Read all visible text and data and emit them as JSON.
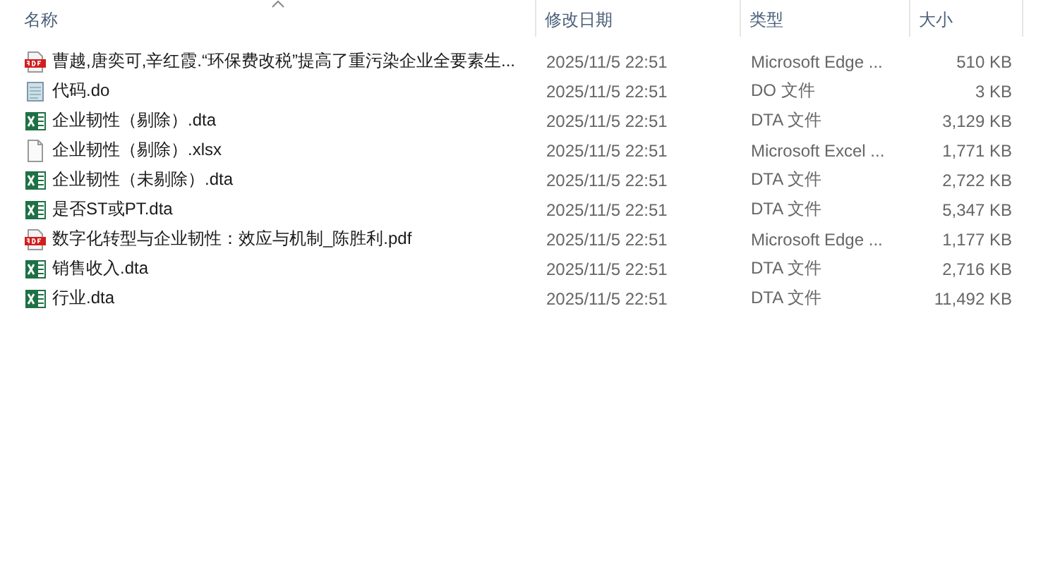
{
  "columns": [
    {
      "label": "名称",
      "sorted": true
    },
    {
      "label": "修改日期",
      "sorted": false
    },
    {
      "label": "类型",
      "sorted": false
    },
    {
      "label": "大小",
      "sorted": false
    }
  ],
  "rows": [
    {
      "kind": "pdf",
      "name": "曹越,唐奕可,辛红霞.“环保费改税”提高了重污染企业全要素生...",
      "date": "2025/11/5 22:51",
      "type": "Microsoft Edge ...",
      "size": "510 KB"
    },
    {
      "kind": "text",
      "name": "代码.do",
      "date": "2025/11/5 22:51",
      "type": "DO 文件",
      "size": "3 KB"
    },
    {
      "kind": "excel",
      "name": "企业韧性（剔除）.dta",
      "date": "2025/11/5 22:51",
      "type": "DTA 文件",
      "size": "3,129 KB"
    },
    {
      "kind": "blank",
      "name": "企业韧性（剔除）.xlsx",
      "date": "2025/11/5 22:51",
      "type": "Microsoft Excel ...",
      "size": "1,771 KB"
    },
    {
      "kind": "excel",
      "name": "企业韧性（未剔除）.dta",
      "date": "2025/11/5 22:51",
      "type": "DTA 文件",
      "size": "2,722 KB"
    },
    {
      "kind": "excel",
      "name": "是否ST或PT.dta",
      "date": "2025/11/5 22:51",
      "type": "DTA 文件",
      "size": "5,347 KB"
    },
    {
      "kind": "pdf",
      "name": "数字化转型与企业韧性：效应与机制_陈胜利.pdf",
      "date": "2025/11/5 22:51",
      "type": "Microsoft Edge ...",
      "size": "1,177 KB"
    },
    {
      "kind": "excel",
      "name": "销售收入.dta",
      "date": "2025/11/5 22:51",
      "type": "DTA 文件",
      "size": "2,716 KB"
    },
    {
      "kind": "excel",
      "name": "行业.dta",
      "date": "2025/11/5 22:51",
      "type": "DTA 文件",
      "size": "11,492 KB"
    }
  ]
}
